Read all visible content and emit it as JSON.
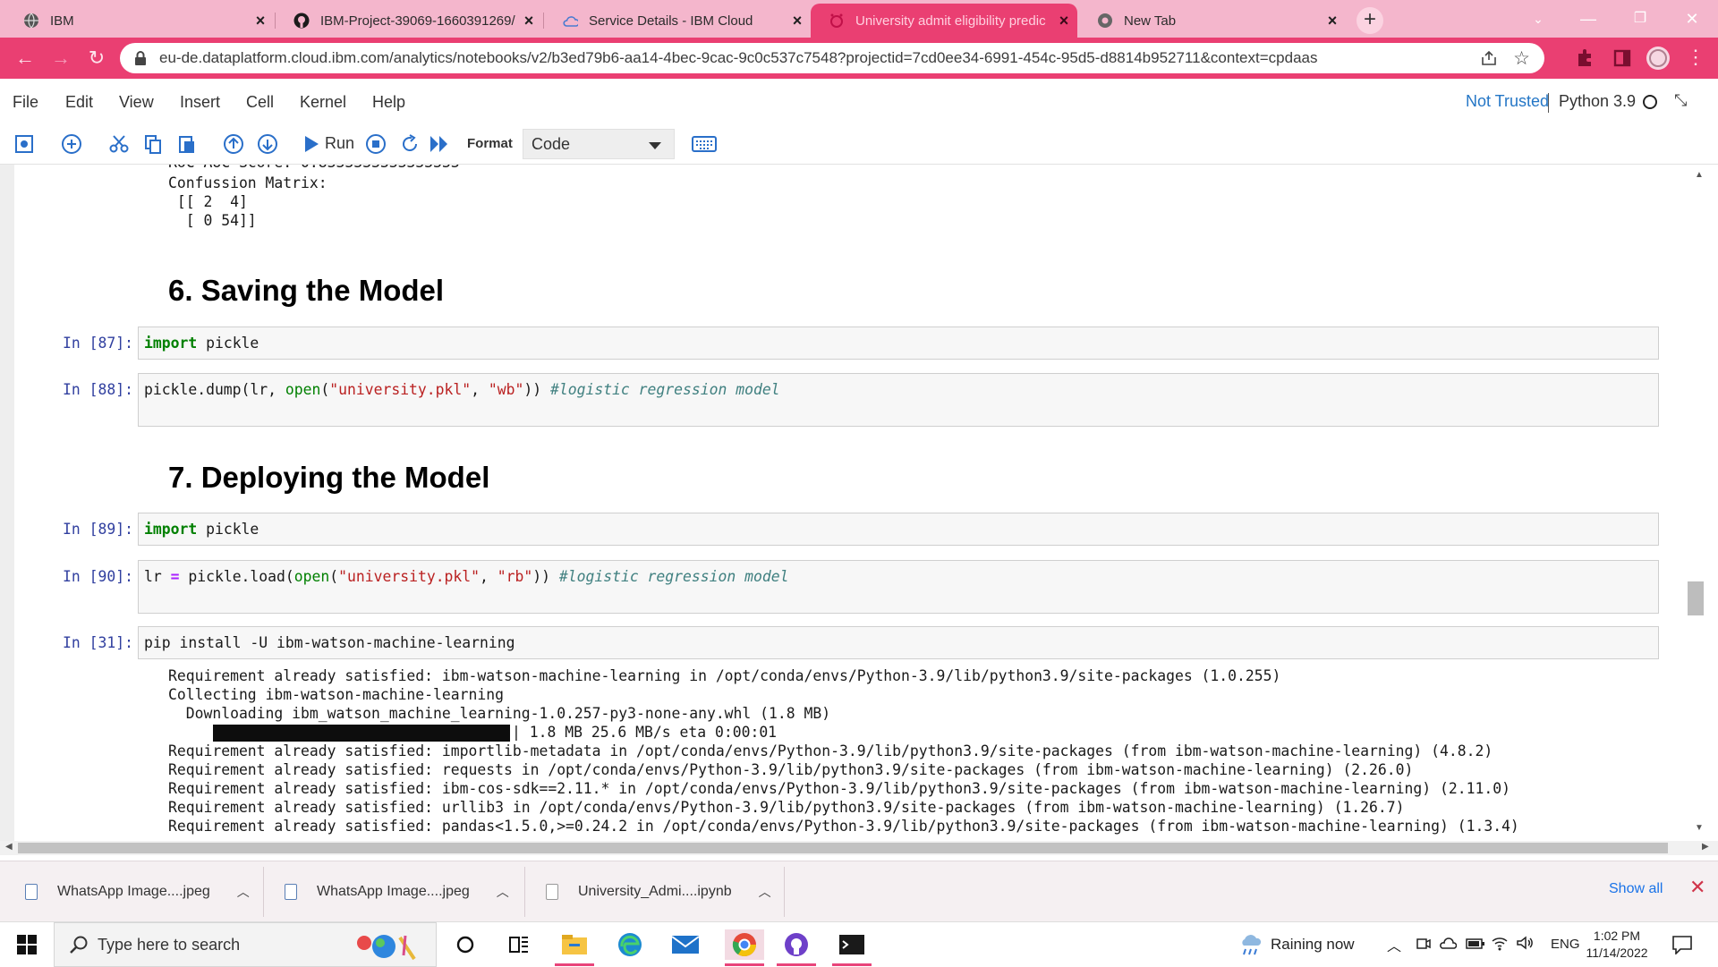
{
  "browser": {
    "tabs": [
      {
        "title": "IBM",
        "active": false
      },
      {
        "title": "IBM-Project-39069-1660391269/",
        "active": false
      },
      {
        "title": "Service Details - IBM Cloud",
        "active": false
      },
      {
        "title": "University admit eligibility predic",
        "active": true
      },
      {
        "title": "New Tab",
        "active": false
      }
    ],
    "url": "eu-de.dataplatform.cloud.ibm.com/analytics/notebooks/v2/b3ed79b6-aa14-4bec-9cac-9c0c537c7548?projectid=7cd0ee34-6991-454c-95d5-d8814b952711&context=cpdaas",
    "accent_color": "#ea3f72"
  },
  "menu": {
    "items": [
      "File",
      "Edit",
      "View",
      "Insert",
      "Cell",
      "Kernel",
      "Help"
    ],
    "trusted": "Not Trusted",
    "kernel": "Python 3.9"
  },
  "toolbar": {
    "run_label": "Run",
    "format_label": "Format",
    "cell_type": "Code"
  },
  "notebook": {
    "top_output": [
      "Confussion Matrix:",
      " [[ 2  4]",
      "  [ 0 54]]"
    ],
    "heading6": "6. Saving the Model",
    "heading7": "7. Deploying the Model",
    "cells": {
      "c87": {
        "prompt": "In [87]:",
        "kw": "import",
        "rest": " pickle"
      },
      "c88": {
        "prompt": "In [88]:",
        "a": "pickle.dump(lr, ",
        "fn": "open",
        "b": "(",
        "s1": "\"university.pkl\"",
        "c": ", ",
        "s2": "\"wb\"",
        "d": ")) ",
        "comment": "#logistic regression model"
      },
      "c89": {
        "prompt": "In [89]:",
        "kw": "import",
        "rest": " pickle"
      },
      "c90": {
        "prompt": "In [90]:",
        "a": "lr ",
        "op": "=",
        "b": " pickle.load(",
        "fn": "open",
        "c": "(",
        "s1": "\"university.pkl\"",
        "d": ", ",
        "s2": "\"rb\"",
        "e": ")) ",
        "comment": "#logistic regression model"
      },
      "c31": {
        "prompt": "In [31]:",
        "code": "pip install -U ibm-watson-machine-learning"
      }
    },
    "pip_output": [
      "Requirement already satisfied: ibm-watson-machine-learning in /opt/conda/envs/Python-3.9/lib/python3.9/site-packages (1.0.255)",
      "Collecting ibm-watson-machine-learning",
      "  Downloading ibm_watson_machine_learning-1.0.257-py3-none-any.whl (1.8 MB)",
      "1.8 MB 25.6 MB/s eta 0:00:01",
      "Requirement already satisfied: importlib-metadata in /opt/conda/envs/Python-3.9/lib/python3.9/site-packages (from ibm-watson-machine-learning) (4.8.2)",
      "Requirement already satisfied: requests in /opt/conda/envs/Python-3.9/lib/python3.9/site-packages (from ibm-watson-machine-learning) (2.26.0)",
      "Requirement already satisfied: ibm-cos-sdk==2.11.* in /opt/conda/envs/Python-3.9/lib/python3.9/site-packages (from ibm-watson-machine-learning) (2.11.0)",
      "Requirement already satisfied: urllib3 in /opt/conda/envs/Python-3.9/lib/python3.9/site-packages (from ibm-watson-machine-learning) (1.26.7)",
      "Requirement already satisfied: pandas<1.5.0,>=0.24.2 in /opt/conda/envs/Python-3.9/lib/python3.9/site-packages (from ibm-watson-machine-learning) (1.3.4)"
    ],
    "download_progress": 1.0
  },
  "downloads": {
    "items": [
      "WhatsApp Image....jpeg",
      "WhatsApp Image....jpeg",
      "University_Admi....ipynb"
    ],
    "show_all": "Show all"
  },
  "taskbar": {
    "search_placeholder": "Type here to search",
    "weather": "Raining now",
    "lang": "ENG",
    "time": "1:02 PM",
    "date": "11/14/2022"
  }
}
